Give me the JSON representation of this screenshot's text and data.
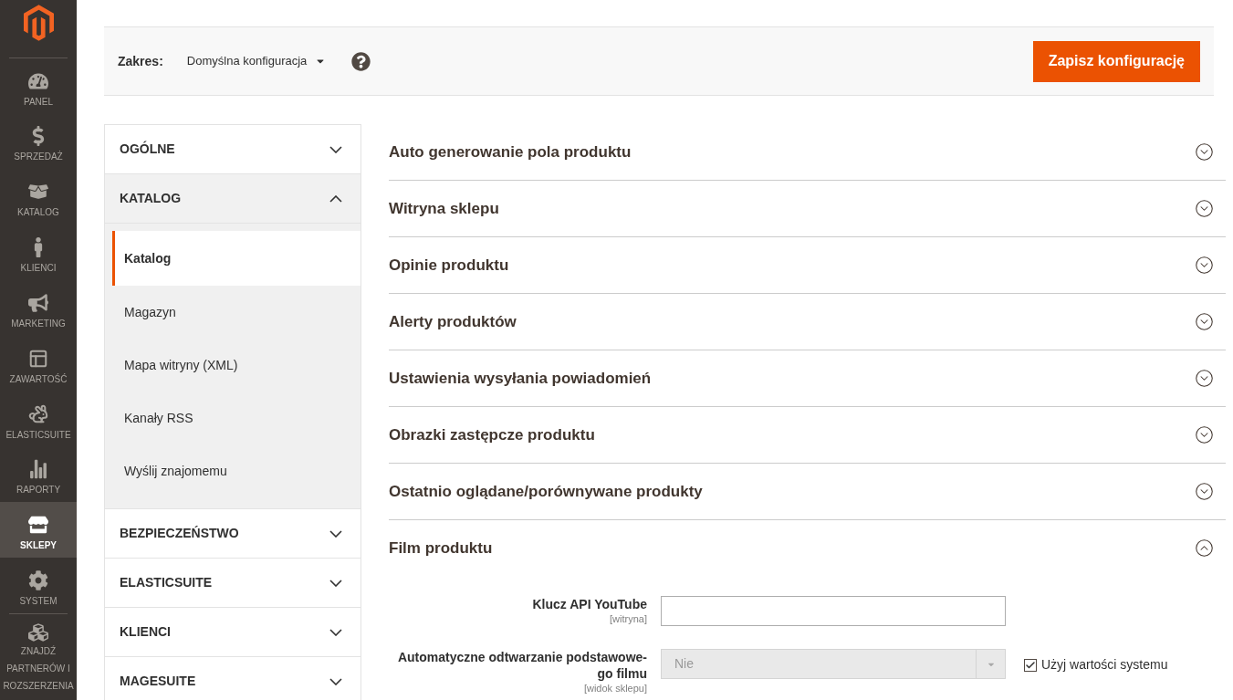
{
  "nav": {
    "items": [
      {
        "label": "PANEL",
        "selected": false
      },
      {
        "label": "SPRZEDAŻ",
        "selected": false
      },
      {
        "label": "KATALOG",
        "selected": false
      },
      {
        "label": "KLIENCI",
        "selected": false
      },
      {
        "label": "MARKETING",
        "selected": false
      },
      {
        "label": "ZAWARTOŚĆ",
        "selected": false
      },
      {
        "label": "ELASTICSUITE",
        "selected": false
      },
      {
        "label": "RAPORTY",
        "selected": false
      },
      {
        "label": "SKLEPY",
        "selected": true
      },
      {
        "label": "SYSTEM",
        "selected": false
      }
    ],
    "extension_item": {
      "label": "ZNAJDŹ PARTNERÓW I ROZSZERZENIA",
      "selected": false
    }
  },
  "scope_bar": {
    "label": "Zakres:",
    "value": "Domyślna konfiguracja",
    "save_button": "Zapisz konfigurację"
  },
  "config_tabs": [
    {
      "label": "OGÓLNE",
      "expanded": false
    },
    {
      "label": "KATALOG",
      "expanded": true,
      "children": [
        {
          "label": "Katalog",
          "selected": true
        },
        {
          "label": "Magazyn",
          "selected": false
        },
        {
          "label": "Mapa witryny (XML)",
          "selected": false
        },
        {
          "label": "Kanały RSS",
          "selected": false
        },
        {
          "label": "Wyślij znajomemu",
          "selected": false
        }
      ]
    },
    {
      "label": "BEZPIECZEŃSTWO",
      "expanded": false
    },
    {
      "label": "ELASTICSUITE",
      "expanded": false
    },
    {
      "label": "KLIENCI",
      "expanded": false
    },
    {
      "label": "MAGESUITE",
      "expanded": false
    }
  ],
  "sections": [
    {
      "title": "Auto generowanie pola produktu",
      "expanded": false
    },
    {
      "title": "Witryna sklepu",
      "expanded": false
    },
    {
      "title": "Opinie produktu",
      "expanded": false
    },
    {
      "title": "Alerty produktów",
      "expanded": false
    },
    {
      "title": "Ustawienia wysyłania powiadomień",
      "expanded": false
    },
    {
      "title": "Obrazki zastępcze produktu",
      "expanded": false
    },
    {
      "title": "Ostatnio oglądane/porównywane produkty",
      "expanded": false
    },
    {
      "title": "Film produktu",
      "expanded": true,
      "fields": [
        {
          "kind": "text",
          "label": "Klucz API YouTube",
          "scope": "[witryna]"
        },
        {
          "kind": "select",
          "label": "Automatyczne odtwarzanie podstawowe-go filmu",
          "scope": "[widok sklepu]",
          "value": "Nie",
          "disabled": true,
          "use_system_value": {
            "label": "Użyj wartości systemu",
            "checked": true
          }
        }
      ]
    }
  ]
}
